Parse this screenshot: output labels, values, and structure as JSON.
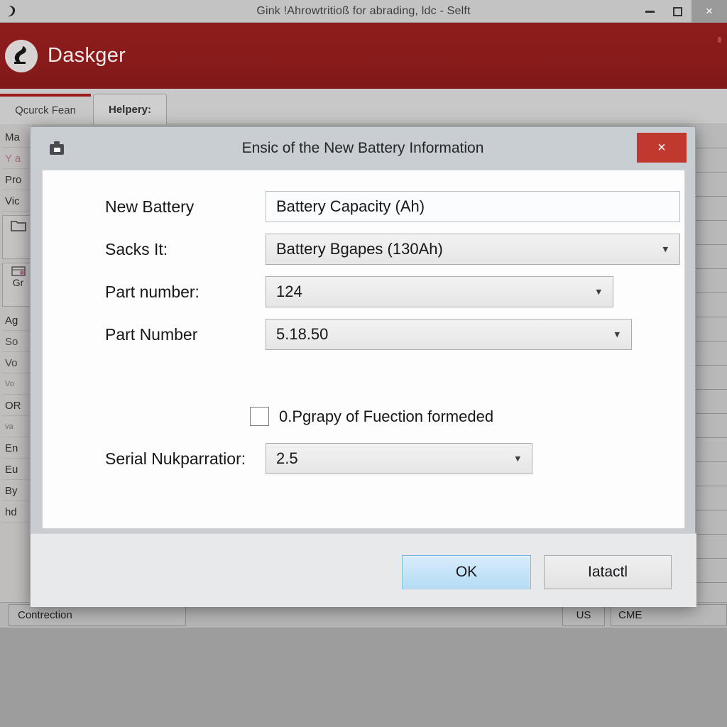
{
  "os_window": {
    "title": "Gink !Ahrowtritioß for abrading, ldc - Selft",
    "icon": "app-icon",
    "controls": {
      "minimize": "–",
      "maximize": "❑",
      "close": "×"
    }
  },
  "brand": {
    "name": "Daskger",
    "logo": "circle-figure-logo",
    "color": "#8f1d1d"
  },
  "tabs": [
    {
      "label": "Qcurck Fean",
      "active": true
    },
    {
      "label": "Helpery:",
      "active": false
    }
  ],
  "sidebar": {
    "items": [
      {
        "label": "Ma"
      },
      {
        "label": "Y a"
      },
      {
        "label": "Pro"
      },
      {
        "label": "Vic"
      },
      {
        "label": "⎇"
      },
      {
        "label": "Gr"
      },
      {
        "label": "Ag"
      },
      {
        "label": "So"
      },
      {
        "label": "Vo"
      },
      {
        "label": "Vo"
      },
      {
        "label": "OR"
      },
      {
        "label": "va"
      },
      {
        "label": "En"
      },
      {
        "label": "Eu"
      },
      {
        "label": "By"
      },
      {
        "label": "hd"
      }
    ]
  },
  "statusbar": {
    "connection": "Contrection",
    "locale": "US",
    "mode": "CME"
  },
  "dialog": {
    "title": "Ensic of the New Battery Information",
    "icon": "toolbox-icon",
    "close_label": "×",
    "fields": [
      {
        "label": "New Battery",
        "value": "Battery Capacity (Ah)",
        "type": "textbox"
      },
      {
        "label": "Sacks It:",
        "value": "Battery Bgapes (130Ah)",
        "type": "combobox"
      },
      {
        "label": "Part number:",
        "value": "124",
        "type": "combobox"
      },
      {
        "label": "Part Number",
        "value": "5.18.50",
        "type": "combobox"
      },
      {
        "label": "Serial Nukparratior:",
        "value": "2.5",
        "type": "combobox"
      }
    ],
    "checkbox": {
      "label": "0.Pgrapy of Fuection formeded",
      "checked": false
    },
    "buttons": {
      "ok": "OK",
      "cancel": "Iatactl"
    },
    "accent_color": "#72b4dd",
    "close_color": "#c0392f"
  }
}
